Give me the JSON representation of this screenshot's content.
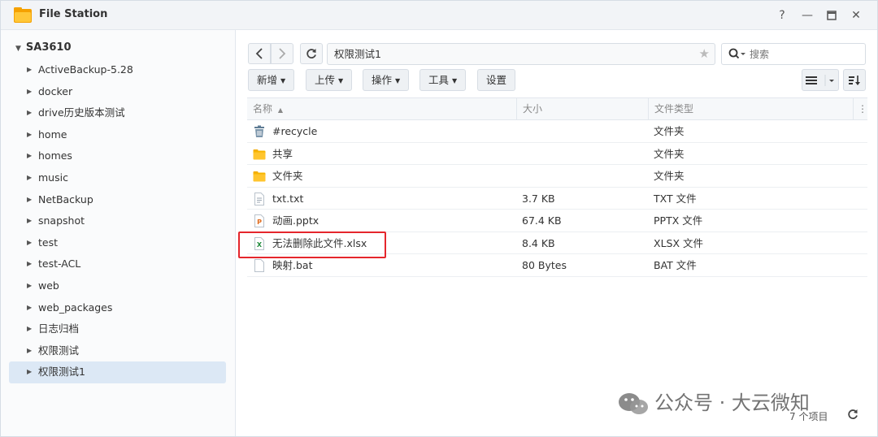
{
  "window": {
    "title": "File Station",
    "help": "?",
    "minimize": "—",
    "maximize": "▭",
    "close": "✕"
  },
  "sidebar": {
    "root": "SA3610",
    "items": [
      {
        "label": "ActiveBackup-5.28"
      },
      {
        "label": "docker"
      },
      {
        "label": "drive历史版本测试"
      },
      {
        "label": "home"
      },
      {
        "label": "homes"
      },
      {
        "label": "music"
      },
      {
        "label": "NetBackup"
      },
      {
        "label": "snapshot"
      },
      {
        "label": "test"
      },
      {
        "label": "test-ACL"
      },
      {
        "label": "web"
      },
      {
        "label": "web_packages"
      },
      {
        "label": "日志归档"
      },
      {
        "label": "权限测试"
      },
      {
        "label": "权限测试1"
      }
    ],
    "selected_index": 14
  },
  "nav": {
    "back": "‹",
    "forward": "›",
    "refresh": "C",
    "path": "权限测试1"
  },
  "search": {
    "placeholder": "搜索"
  },
  "toolbar": {
    "create": "新增",
    "upload": "上传",
    "action": "操作",
    "tools": "工具",
    "settings": "设置"
  },
  "table": {
    "headers": {
      "name": "名称",
      "sort_indicator": "▲",
      "size": "大小",
      "type": "文件类型"
    },
    "rows": [
      {
        "name": "#recycle",
        "size": "",
        "type": "文件夹",
        "icon": "recycle-bin-icon"
      },
      {
        "name": "共享",
        "size": "",
        "type": "文件夹",
        "icon": "folder-icon"
      },
      {
        "name": "文件夹",
        "size": "",
        "type": "文件夹",
        "icon": "folder-icon"
      },
      {
        "name": "txt.txt",
        "size": "3.7 KB",
        "type": "TXT 文件",
        "icon": "text-file-icon"
      },
      {
        "name": "动画.pptx",
        "size": "67.4 KB",
        "type": "PPTX 文件",
        "icon": "pptx-file-icon"
      },
      {
        "name": "无法删除此文件.xlsx",
        "size": "8.4 KB",
        "type": "XLSX 文件",
        "icon": "xlsx-file-icon"
      },
      {
        "name": "映射.bat",
        "size": "80 Bytes",
        "type": "BAT 文件",
        "icon": "bat-file-icon"
      }
    ]
  },
  "footer": {
    "count": "7 个项目"
  },
  "watermark": {
    "text": "公众号 · 大云微知"
  },
  "colors": {
    "accent": "#dce8f5",
    "highlight": "#e5262c",
    "folder": "#f7b500"
  }
}
